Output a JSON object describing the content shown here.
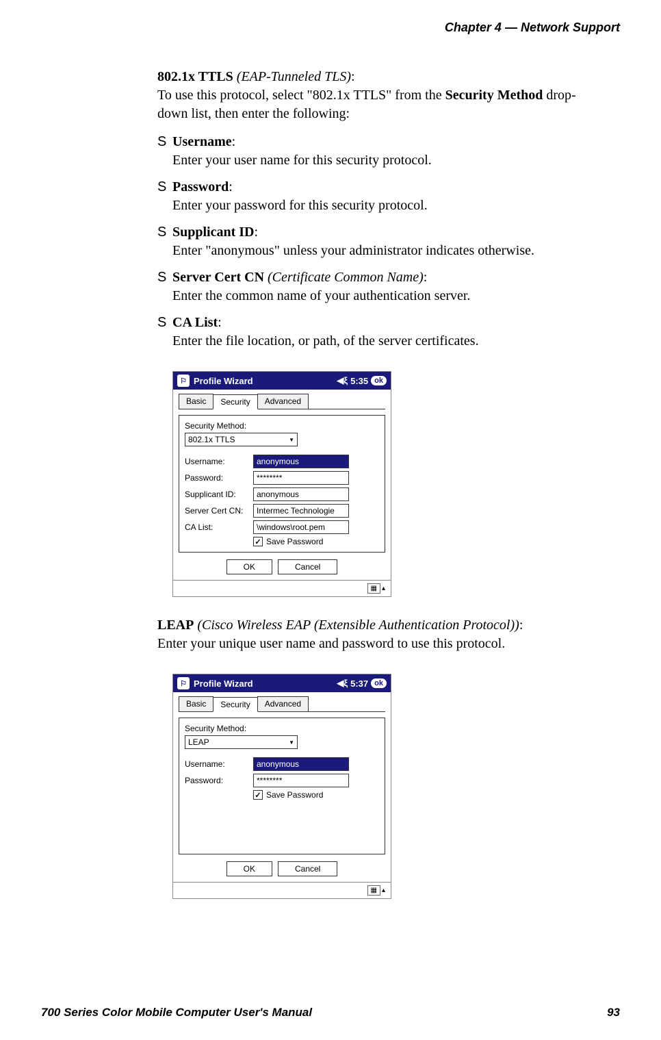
{
  "header": {
    "chapter": "Chapter  4",
    "sep": "—",
    "title": "Network Support"
  },
  "section1": {
    "title_bold": "802.1x TTLS",
    "title_italic": " (EAP-Tunneled TLS)",
    "title_colon": ":",
    "desc_part1": "To use this protocol, select \"802.1x TTLS\" from the ",
    "desc_bold": "Security Method",
    "desc_part2": " drop-down list, then enter the following:",
    "bullets": [
      {
        "label": "Username",
        "colon": ":",
        "text": "Enter your user name for this security protocol."
      },
      {
        "label": "Password",
        "colon": ":",
        "text": "Enter your password for this security protocol."
      },
      {
        "label": "Supplicant ID",
        "colon": ":",
        "text": "Enter \"anonymous\" unless your administrator indicates otherwise."
      },
      {
        "label": "Server Cert CN",
        "label_italic": " (Certificate Common Name)",
        "colon": ":",
        "text": "Enter the common name of your authentication server."
      },
      {
        "label": "CA List",
        "colon": ":",
        "text": "Enter the file location, or path, of the server certificates."
      }
    ]
  },
  "screenshot1": {
    "title": "Profile Wizard",
    "time": "5:35",
    "ok": "ok",
    "tabs": [
      "Basic",
      "Security",
      "Advanced"
    ],
    "active_tab": 1,
    "method_label": "Security Method:",
    "method_value": "802.1x TTLS",
    "fields": [
      {
        "label": "Username:",
        "value": "anonymous",
        "selected": true
      },
      {
        "label": "Password:",
        "value": "********",
        "selected": false
      },
      {
        "label": "Supplicant ID:",
        "value": "anonymous",
        "selected": false
      },
      {
        "label": "Server Cert CN:",
        "value": "Intermec Technologie",
        "selected": false
      },
      {
        "label": "CA List:",
        "value": "\\windows\\root.pem",
        "selected": false
      }
    ],
    "checkbox": {
      "checked": true,
      "label": "Save Password"
    },
    "buttons": {
      "ok": "OK",
      "cancel": "Cancel"
    }
  },
  "section2": {
    "title_bold": "LEAP",
    "title_italic": " (Cisco Wireless EAP (Extensible Authentication Protocol))",
    "title_colon": ":",
    "desc": "Enter your unique user name and password to use this protocol."
  },
  "screenshot2": {
    "title": "Profile Wizard",
    "time": "5:37",
    "ok": "ok",
    "tabs": [
      "Basic",
      "Security",
      "Advanced"
    ],
    "active_tab": 1,
    "method_label": "Security Method:",
    "method_value": "LEAP",
    "fields": [
      {
        "label": "Username:",
        "value": "anonymous",
        "selected": true
      },
      {
        "label": "Password:",
        "value": "********",
        "selected": false
      }
    ],
    "checkbox": {
      "checked": true,
      "label": "Save Password"
    },
    "buttons": {
      "ok": "OK",
      "cancel": "Cancel"
    }
  },
  "footer": {
    "left": "700 Series Color Mobile Computer User's Manual",
    "right": "93"
  }
}
